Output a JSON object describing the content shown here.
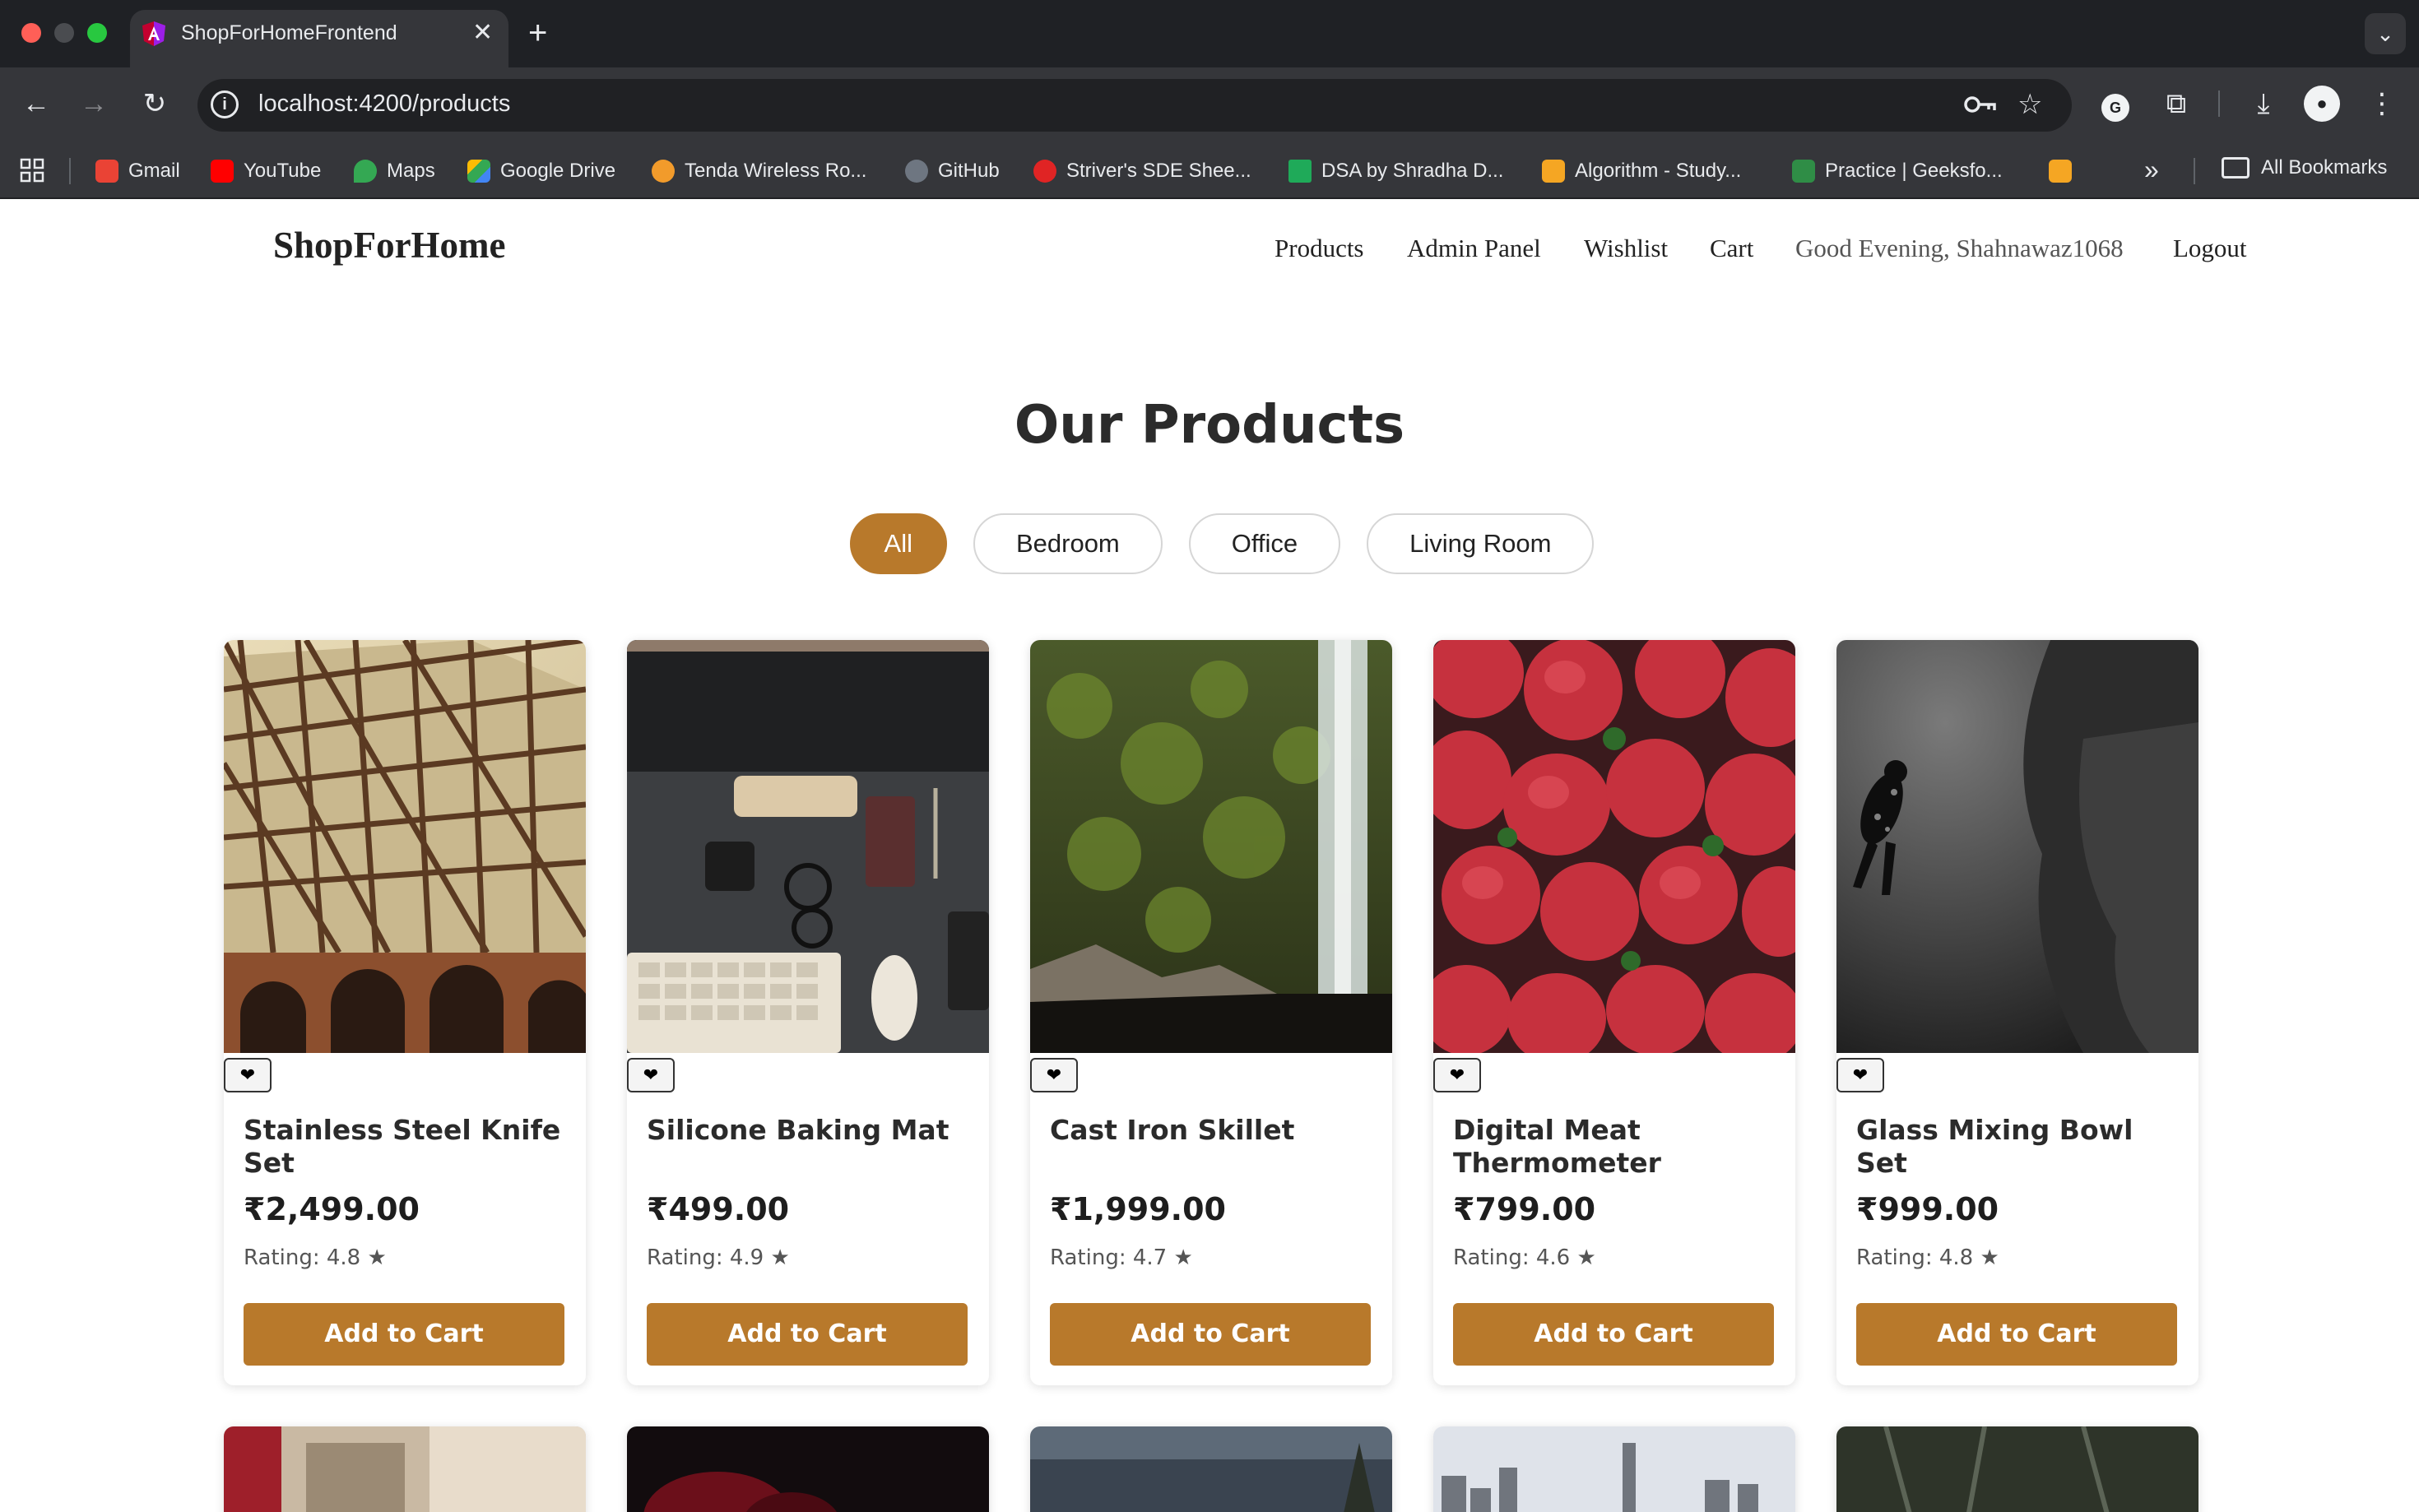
{
  "browser": {
    "tab_title": "ShopForHomeFrontend",
    "url": "localhost:4200/products",
    "bookmarks": [
      {
        "label": "Gmail",
        "color": "#ea4335"
      },
      {
        "label": "YouTube",
        "color": "#ff0000"
      },
      {
        "label": "Maps",
        "color": "#34a853"
      },
      {
        "label": "Google Drive",
        "color": "#fbbc04"
      },
      {
        "label": "Tenda Wireless Ro...",
        "color": "#f29b2b"
      },
      {
        "label": "GitHub",
        "color": "#6e7681"
      },
      {
        "label": "Striver's SDE Shee...",
        "color": "#e02424"
      },
      {
        "label": "DSA by Shradha D...",
        "color": "#1faa59"
      },
      {
        "label": "Algorithm - Study...",
        "color": "#f5a623"
      },
      {
        "label": "Practice | Geeksfo...",
        "color": "#2f8d46"
      }
    ],
    "all_bookmarks": "All Bookmarks"
  },
  "site": {
    "brand": "ShopForHome",
    "nav": {
      "products": "Products",
      "admin": "Admin Panel",
      "wishlist": "Wishlist",
      "cart": "Cart",
      "greeting": "Good Evening, Shahnawaz1068",
      "logout": "Logout"
    }
  },
  "main": {
    "title": "Our Products",
    "filters": [
      "All",
      "Bedroom",
      "Office",
      "Living Room"
    ],
    "active_filter": "All",
    "accent": "#b8792b",
    "products": [
      {
        "name": "Stainless Steel Knife Set",
        "price": "₹2,499.00",
        "rating": "Rating: 4.8 ★",
        "wish": "❤",
        "cta": "Add to Cart"
      },
      {
        "name": "Silicone Baking Mat",
        "price": "₹499.00",
        "rating": "Rating: 4.9 ★",
        "wish": "❤",
        "cta": "Add to Cart"
      },
      {
        "name": "Cast Iron Skillet",
        "price": "₹1,999.00",
        "rating": "Rating: 4.7 ★",
        "wish": "❤",
        "cta": "Add to Cart"
      },
      {
        "name": "Digital Meat Thermometer",
        "price": "₹799.00",
        "rating": "Rating: 4.6 ★",
        "wish": "❤",
        "cta": "Add to Cart"
      },
      {
        "name": "Glass Mixing Bowl Set",
        "price": "₹999.00",
        "rating": "Rating: 4.8 ★",
        "wish": "❤",
        "cta": "Add to Cart"
      }
    ]
  }
}
